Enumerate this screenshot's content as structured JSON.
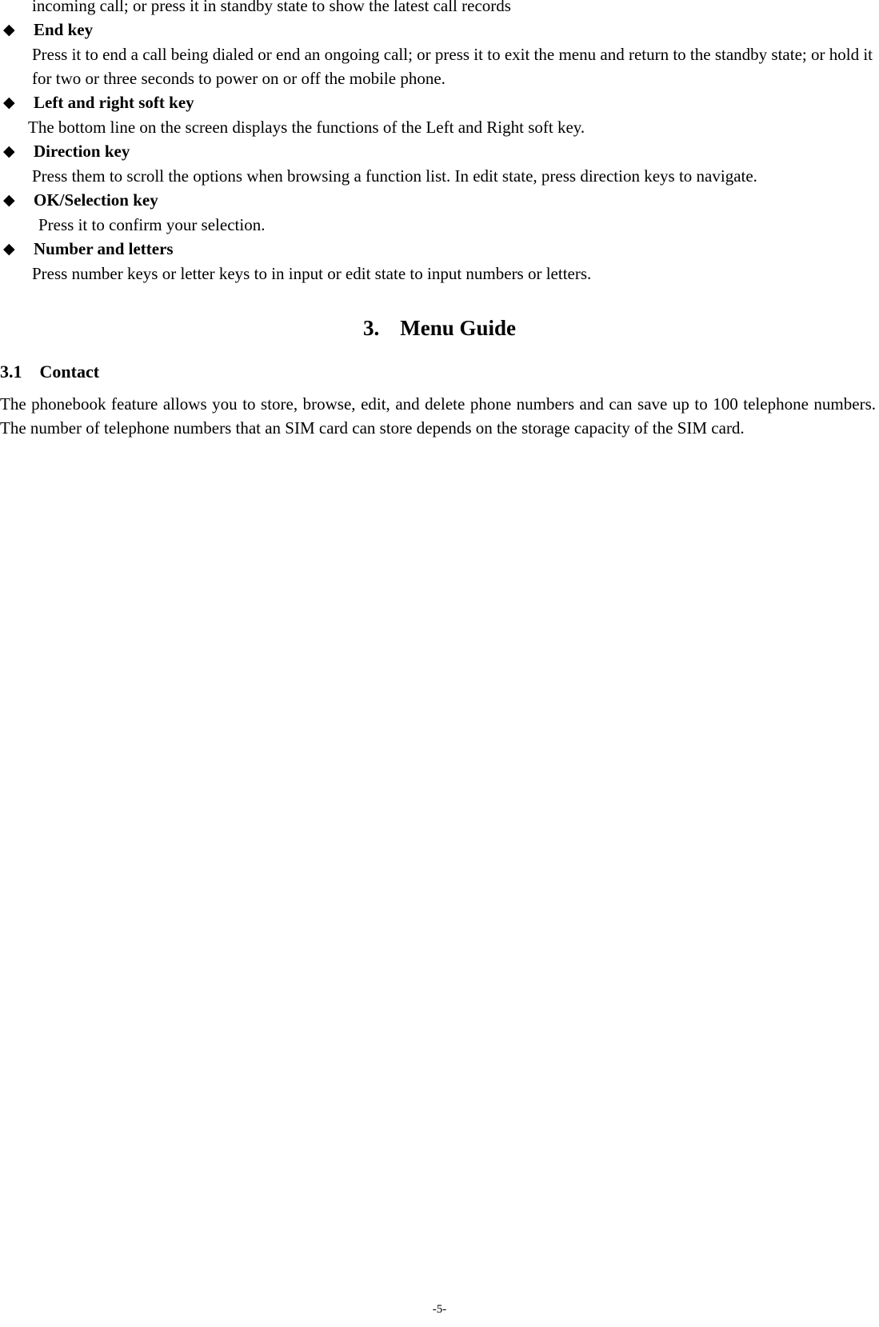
{
  "document": {
    "page_number_label": "-5-",
    "bullet_glyph": "◆",
    "bullet_glyph_name": "diamond-bullet-icon"
  },
  "top_continuation_line": "incoming call; or press it in standby state to show the latest call records",
  "key_guide": {
    "items": [
      {
        "title": "End key",
        "body": "Press it to end a call being dialed or end an ongoing call; or press it to exit the menu and return to the standby state; or hold it for two or three seconds to power on or off the mobile phone."
      },
      {
        "title": "Left and right soft key",
        "body": "The bottom line on the screen displays the functions of the Left and Right soft key."
      },
      {
        "title": "Direction key",
        "body": "Press them to scroll the options when browsing a function list. In edit state, press direction keys to navigate."
      },
      {
        "title": "OK/Selection key",
        "body": "Press it to confirm your selection."
      },
      {
        "title": "Number and letters",
        "body": "Press number keys or letter keys to in input or edit state to input numbers or letters."
      }
    ]
  },
  "section": {
    "number": "3.",
    "title": "Menu Guide"
  },
  "subsection": {
    "number": "3.1",
    "title": "Contact",
    "body": "The phonebook feature allows you to store, browse, edit, and delete phone numbers and can save up to 100 telephone numbers. The number of telephone numbers that an SIM card can store depends on the storage capacity of the SIM card."
  }
}
